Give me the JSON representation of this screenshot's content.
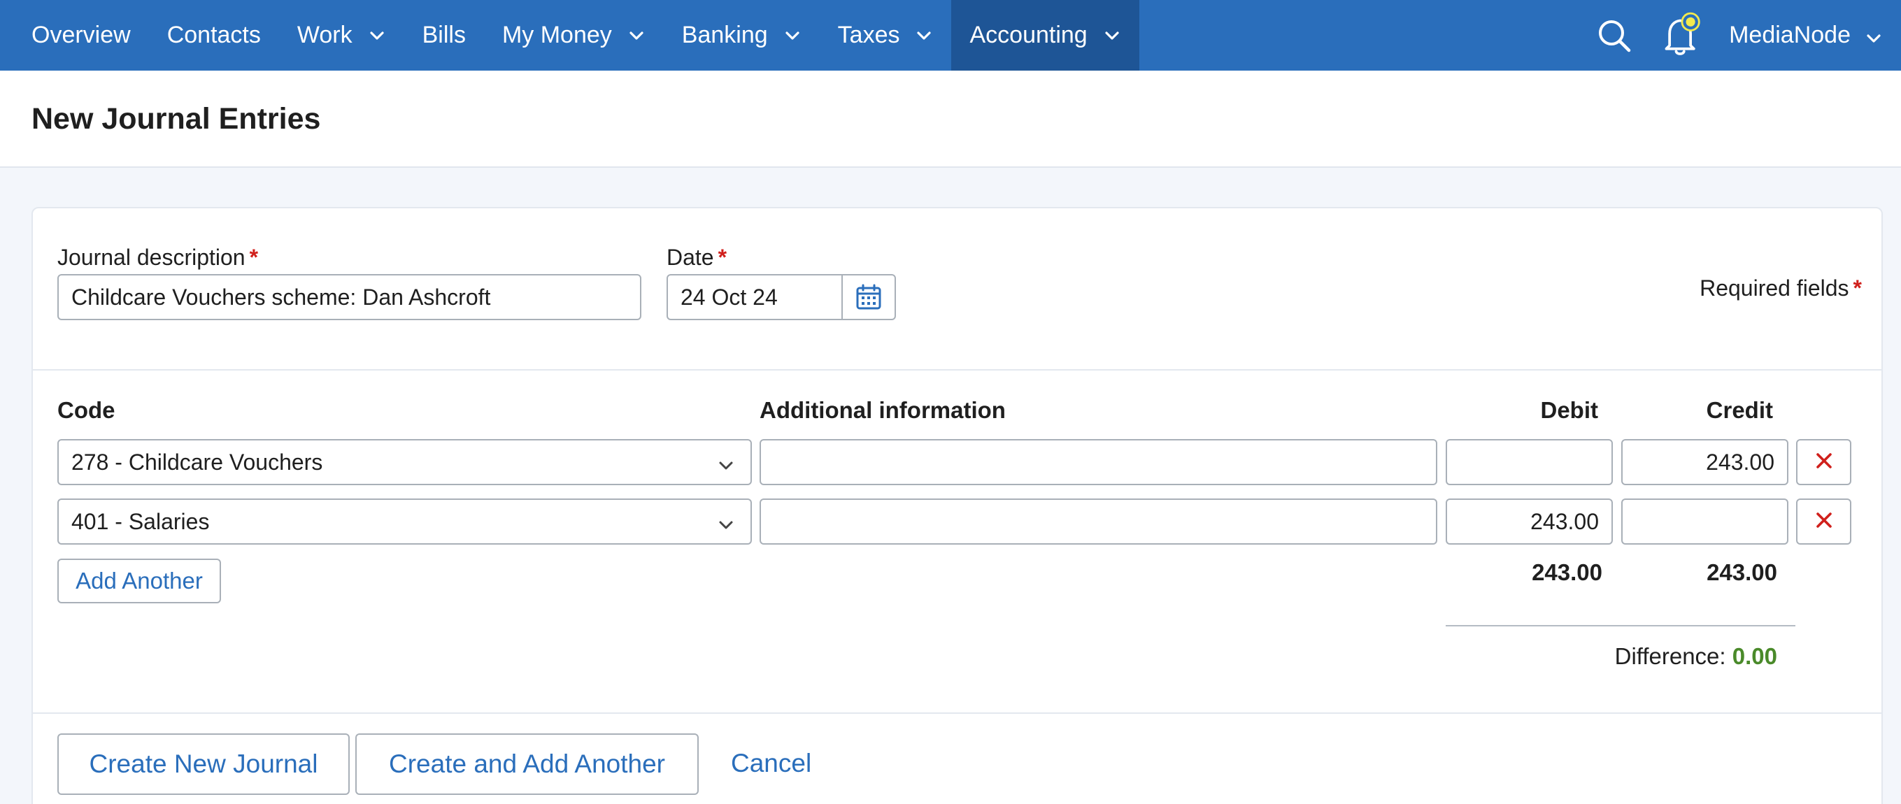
{
  "nav": {
    "items": [
      {
        "label": "Overview",
        "has_dropdown": false
      },
      {
        "label": "Contacts",
        "has_dropdown": false
      },
      {
        "label": "Work",
        "has_dropdown": true
      },
      {
        "label": "Bills",
        "has_dropdown": false
      },
      {
        "label": "My Money",
        "has_dropdown": true
      },
      {
        "label": "Banking",
        "has_dropdown": true
      },
      {
        "label": "Taxes",
        "has_dropdown": true
      },
      {
        "label": "Accounting",
        "has_dropdown": true,
        "active": true
      }
    ],
    "account_name": "MediaNode",
    "icons": {
      "search": "search-icon",
      "notifications": "bell-icon"
    }
  },
  "page": {
    "title": "New Journal Entries"
  },
  "form": {
    "description_label": "Journal description",
    "description_value": "Childcare Vouchers scheme: Dan Ashcroft",
    "date_label": "Date",
    "date_value": "24 Oct 24",
    "required_marker": "*",
    "required_note": "Required fields",
    "columns": {
      "code": "Code",
      "additional": "Additional information",
      "debit": "Debit",
      "credit": "Credit"
    },
    "lines": [
      {
        "code": "278 - Childcare Vouchers",
        "additional": "",
        "debit": "",
        "credit": "243.00"
      },
      {
        "code": "401 - Salaries",
        "additional": "",
        "debit": "243.00",
        "credit": ""
      }
    ],
    "add_another_label": "Add Another",
    "totals": {
      "debit": "243.00",
      "credit": "243.00"
    },
    "difference_label": "Difference:",
    "difference_value": "0.00"
  },
  "actions": {
    "create_label": "Create New Journal",
    "create_add_label": "Create and Add Another",
    "cancel_label": "Cancel"
  },
  "colors": {
    "nav_bg": "#2a6ebb",
    "nav_active_bg": "#1e5596",
    "link": "#2a6ebb",
    "required": "#d0201c",
    "difference_ok": "#4a8a2a",
    "notification_dot": "#f2e94e"
  }
}
